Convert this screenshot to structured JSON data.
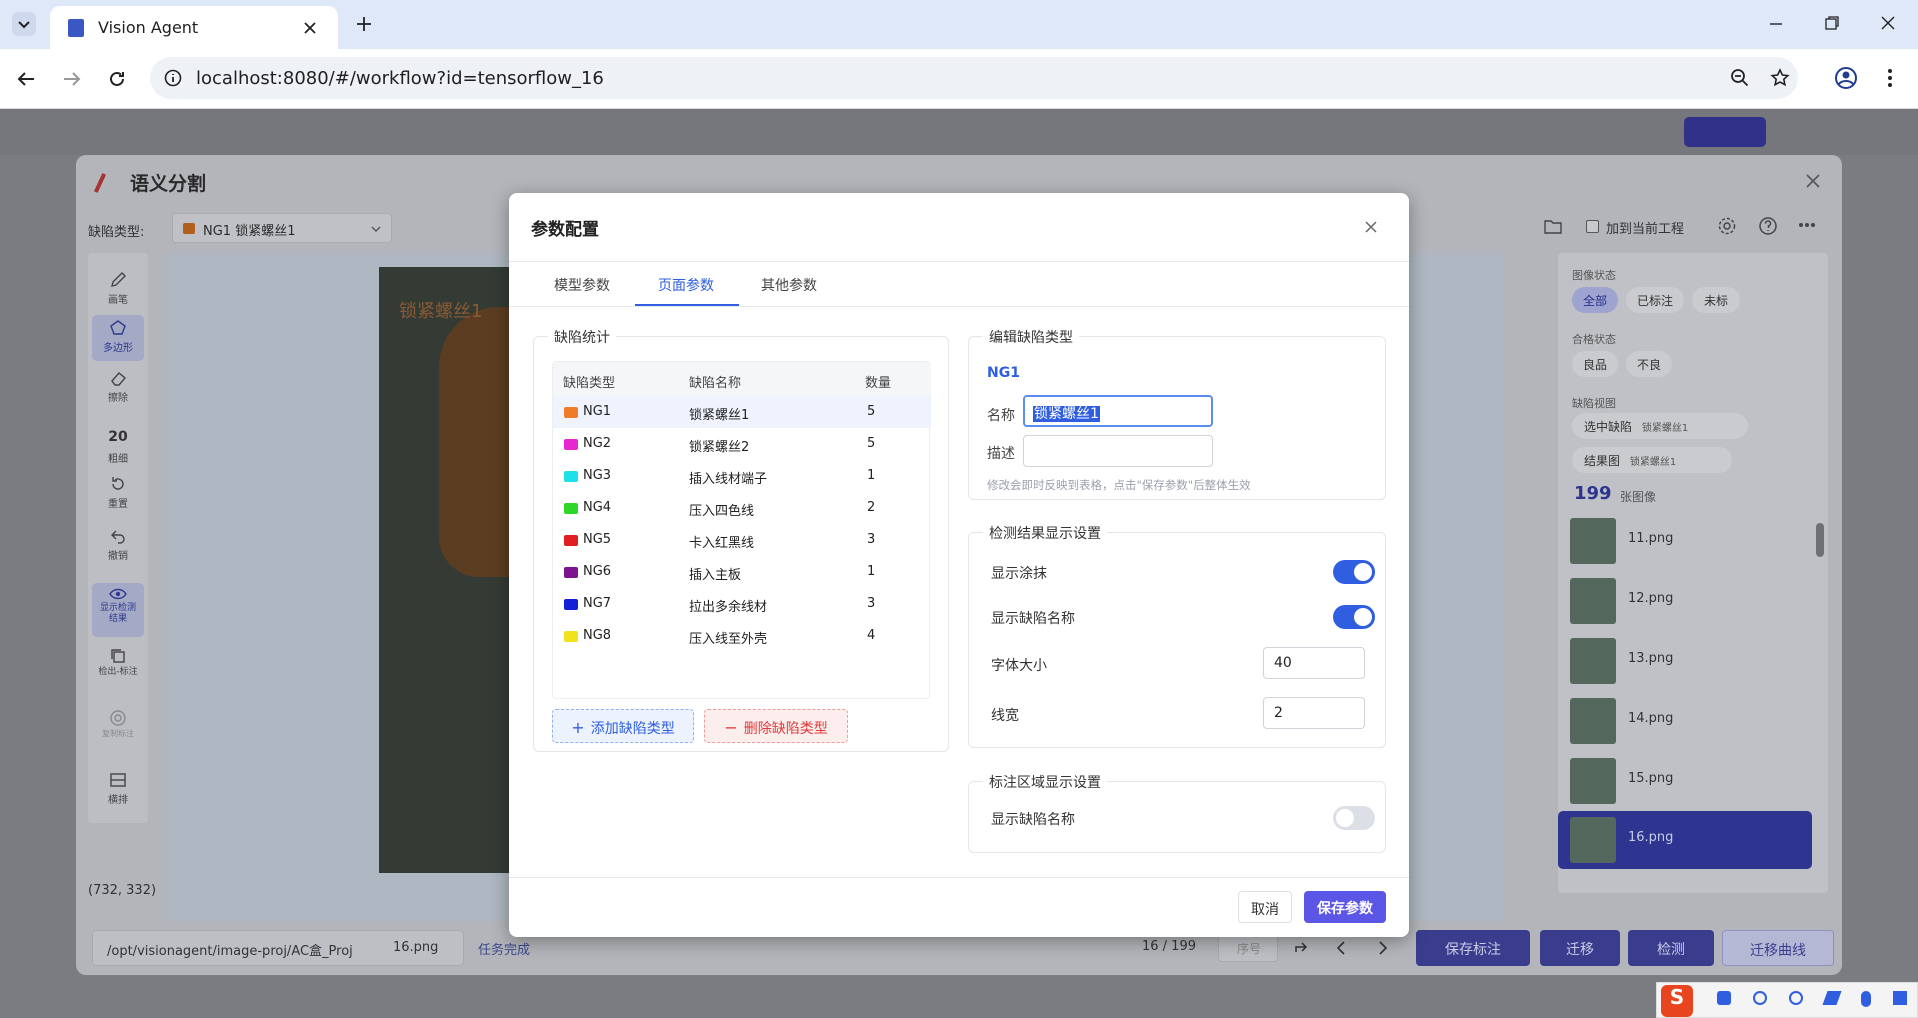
{
  "browser": {
    "tab_title": "Vision Agent",
    "url": "localhost:8080/#/workflow?id=tensorflow_16"
  },
  "background": {
    "panel_title": "语义分割",
    "defect_type_label": "缺陷类型:",
    "defect_type_value": "NG1 锁紧螺丝1",
    "add_to_project": "加到当前工程",
    "tools": [
      {
        "label": "画笔",
        "icon": "brush-icon"
      },
      {
        "label": "多边形",
        "icon": "polygon-icon"
      },
      {
        "label": "擦除",
        "icon": "eraser-icon"
      },
      {
        "label": "20",
        "icon": ""
      },
      {
        "label": "粗细",
        "icon": ""
      },
      {
        "label": "重置",
        "icon": "reset-icon"
      },
      {
        "label": "撤销",
        "icon": "undo-icon"
      },
      {
        "label": "显示检测结果",
        "icon": "eye-icon"
      },
      {
        "label": "检出-标注",
        "icon": "copy-icon"
      },
      {
        "label": "复制标注",
        "icon": "circle-icon"
      },
      {
        "label": "横排",
        "icon": "layout-icon"
      }
    ],
    "canvas_label": "锁紧螺丝1",
    "coords": "(732, 332)",
    "path": "/opt/visionagent/image-proj/AC盒_Proj",
    "filename": "16.png",
    "task_status": "任务完成",
    "page_indicator": "16 / 199",
    "seq_placeholder": "序号",
    "actions": [
      "保存标注",
      "迁移",
      "检测",
      "迁移曲线"
    ],
    "right": {
      "image_state_label": "图像状态",
      "image_state_options": [
        "全部",
        "已标注",
        "未标"
      ],
      "quality_label": "合格状态",
      "quality_options": [
        "良品",
        "不良"
      ],
      "defect_view_label": "缺陷视图",
      "defect_view_options": [
        "选中缺陷",
        "结果图"
      ],
      "defect_view_tag": "锁紧螺丝1",
      "image_count": "199",
      "image_count_unit": "张图像",
      "images": [
        "11.png",
        "12.png",
        "13.png",
        "14.png",
        "15.png",
        "16.png"
      ]
    }
  },
  "modal": {
    "title": "参数配置",
    "tabs": [
      "模型参数",
      "页面参数",
      "其他参数"
    ],
    "active_tab": 1,
    "stats": {
      "legend": "缺陷统计",
      "headers": [
        "缺陷类型",
        "缺陷名称",
        "数量"
      ],
      "rows": [
        {
          "code": "NG1",
          "name": "锁紧螺丝1",
          "count": "5",
          "color": "#f07c2a"
        },
        {
          "code": "NG2",
          "name": "锁紧螺丝2",
          "count": "5",
          "color": "#e629cf"
        },
        {
          "code": "NG3",
          "name": "插入线材端子",
          "count": "1",
          "color": "#1ee0e8"
        },
        {
          "code": "NG4",
          "name": "压入四色线",
          "count": "2",
          "color": "#2ed62a"
        },
        {
          "code": "NG5",
          "name": "卡入红黑线",
          "count": "3",
          "color": "#e02020"
        },
        {
          "code": "NG6",
          "name": "插入主板",
          "count": "1",
          "color": "#7c1490"
        },
        {
          "code": "NG7",
          "name": "拉出多余线材",
          "count": "3",
          "color": "#1420d8"
        },
        {
          "code": "NG8",
          "name": "压入线至外壳",
          "count": "4",
          "color": "#f2e21c"
        }
      ],
      "add_button": "添加缺陷类型",
      "delete_button": "删除缺陷类型"
    },
    "edit": {
      "legend": "编辑缺陷类型",
      "code": "NG1",
      "name_label": "名称",
      "name_value": "锁紧螺丝1",
      "desc_label": "描述",
      "desc_value": "",
      "hint": "修改会即时反映到表格，点击\"保存参数\"后整体生效"
    },
    "display": {
      "legend": "检测结果显示设置",
      "show_paint_label": "显示涂抹",
      "show_paint": true,
      "show_name_label": "显示缺陷名称",
      "show_name": true,
      "font_size_label": "字体大小",
      "font_size": "40",
      "line_width_label": "线宽",
      "line_width": "2"
    },
    "annotation": {
      "legend": "标注区域显示设置",
      "show_name_label": "显示缺陷名称",
      "show_name": false
    },
    "cancel": "取消",
    "save": "保存参数"
  },
  "colors": {
    "accent": "#3f51d6",
    "primary_button": "#5b56e6",
    "danger": "#e03a3a"
  }
}
